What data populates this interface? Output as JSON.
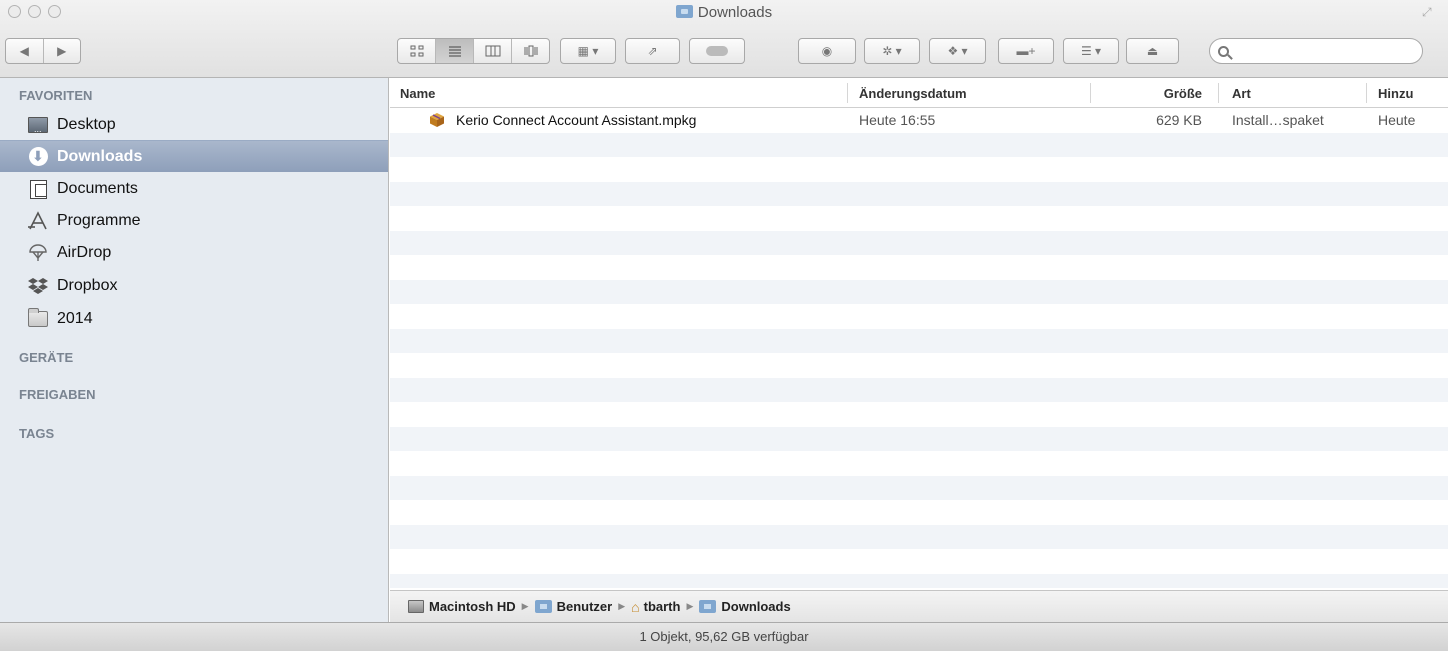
{
  "window": {
    "title": "Downloads"
  },
  "toolbar": {
    "search_placeholder": ""
  },
  "sidebar": {
    "sections": [
      {
        "title": "FAVORITEN"
      },
      {
        "title": "GERÄTE"
      },
      {
        "title": "FREIGABEN"
      },
      {
        "title": "TAGS"
      }
    ],
    "favorites": [
      {
        "label": "Desktop",
        "icon": "desktop-icon"
      },
      {
        "label": "Downloads",
        "icon": "downloads-icon",
        "selected": true
      },
      {
        "label": "Documents",
        "icon": "documents-icon"
      },
      {
        "label": "Programme",
        "icon": "applications-icon"
      },
      {
        "label": "AirDrop",
        "icon": "airdrop-icon"
      },
      {
        "label": "Dropbox",
        "icon": "dropbox-icon"
      },
      {
        "label": "2014",
        "icon": "folder-icon"
      }
    ]
  },
  "list": {
    "columns": {
      "name": "Name",
      "date": "Änderungsdatum",
      "size": "Größe",
      "kind": "Art",
      "added": "Hinzu"
    },
    "files": [
      {
        "name": "Kerio Connect Account Assistant.mpkg",
        "date": "Heute 16:55",
        "size": "629 KB",
        "kind": "Install…spaket",
        "added": "Heute"
      }
    ]
  },
  "pathbar": {
    "crumbs": [
      "Macintosh HD",
      "Benutzer",
      "tbarth",
      "Downloads"
    ]
  },
  "statusbar": {
    "text": "1 Objekt, 95,62 GB verfügbar"
  },
  "colors": {
    "sidebar_bg": "#e6ebf1",
    "selection": "#8e9fba",
    "row_stripe": "#f1f4f8"
  }
}
